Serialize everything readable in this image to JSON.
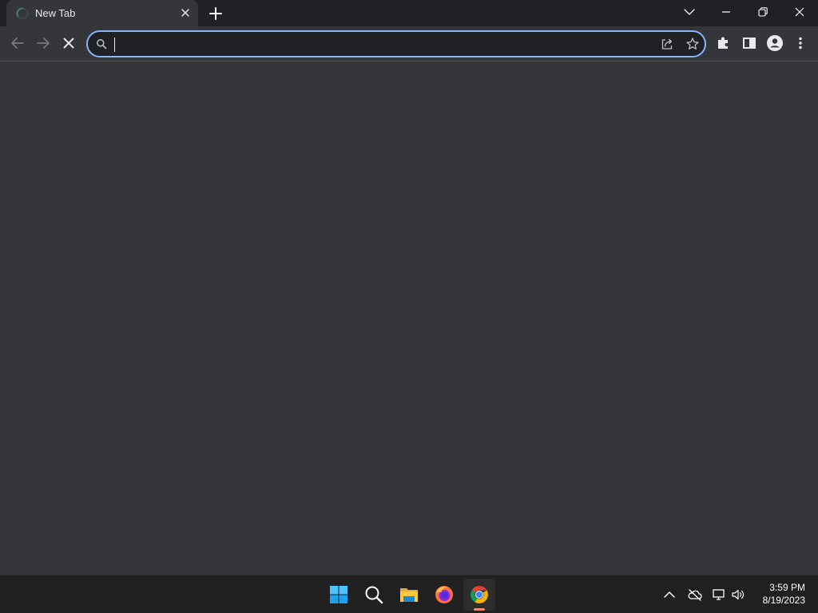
{
  "colors": {
    "tabstrip_bg": "#202124",
    "page_bg": "#35363a",
    "omnibox_focus": "#8ab4f8",
    "taskbar_bg": "#202020",
    "active_indicator": "#f28b66"
  },
  "tabs": [
    {
      "title": "New Tab",
      "loading": true,
      "active": true
    }
  ],
  "tab_icons": {
    "loading": "loading-spinner-icon",
    "close": "close-icon",
    "new_tab": "plus-icon",
    "tab_search": "chevron-down-icon"
  },
  "window_controls": [
    "minimize-icon",
    "restore-icon",
    "close-icon"
  ],
  "toolbar": {
    "back_enabled": false,
    "forward_enabled": false,
    "loading": true,
    "icons": [
      "arrow-left-icon",
      "arrow-right-icon",
      "close-icon",
      "puzzle-icon",
      "side-panel-icon",
      "profile-icon",
      "more-vertical-icon"
    ]
  },
  "omnibox": {
    "value": "",
    "focused": true,
    "icons": [
      "search-icon",
      "share-icon",
      "star-icon"
    ]
  },
  "taskbar": {
    "apps": [
      {
        "name": "Start",
        "icon": "windows-icon",
        "active": false
      },
      {
        "name": "Search",
        "icon": "search-icon",
        "active": false
      },
      {
        "name": "File Explorer",
        "icon": "folder-icon",
        "active": false
      },
      {
        "name": "Firefox",
        "icon": "firefox-icon",
        "active": false
      },
      {
        "name": "Chrome",
        "icon": "chrome-icon",
        "active": true
      }
    ],
    "tray_icons": [
      "chevron-up-icon",
      "cloud-off-icon",
      "network-icon",
      "volume-icon"
    ],
    "time": "3:59 PM",
    "date": "8/19/2023"
  }
}
